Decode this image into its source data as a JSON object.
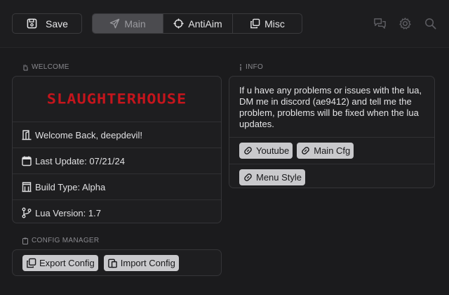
{
  "toolbar": {
    "save_label": "Save"
  },
  "tabs": [
    {
      "label": "Main",
      "active": true
    },
    {
      "label": "AntiAim",
      "active": false
    },
    {
      "label": "Misc",
      "active": false
    }
  ],
  "top_icons": [
    "chat-icon",
    "gear-icon",
    "search-icon"
  ],
  "welcome": {
    "title": "WELCOME",
    "logo_text": "SLAUGHTERHOUSE",
    "rows": [
      {
        "icon": "door-icon",
        "text": "Welcome Back, deepdevil!"
      },
      {
        "icon": "calendar-icon",
        "text": "Last Update: 07/21/24"
      },
      {
        "icon": "building-icon",
        "text": "Build Type: Alpha"
      },
      {
        "icon": "branch-icon",
        "text": "Lua Version: 1.7"
      }
    ]
  },
  "config": {
    "title": "CONFIG MANAGER",
    "export_label": "Export Config",
    "import_label": "Import Config"
  },
  "info": {
    "title": "INFO",
    "text": "If u have any problems or issues with the lua, DM me in discord (ae9412) and tell me the problem, problems will be fixed when the lua updates.",
    "links": [
      {
        "label": "Youtube"
      },
      {
        "label": "Main Cfg"
      },
      {
        "label": "Menu Style"
      }
    ]
  },
  "colors": {
    "background": "#1b1b1d",
    "panel": "#1e1e20",
    "accent_logo": "#c4151c",
    "pill": "#c9c9cc",
    "active_tab": "#4b4b4f"
  }
}
